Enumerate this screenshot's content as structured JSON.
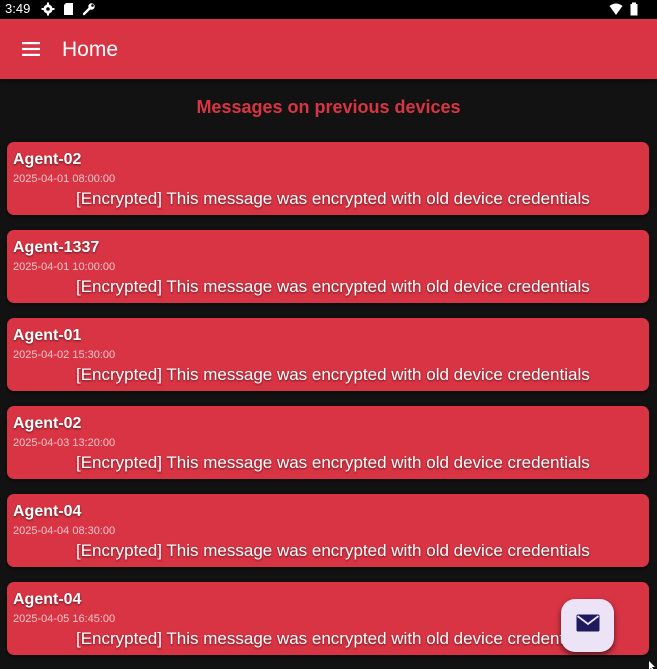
{
  "status_bar": {
    "time": "3:49",
    "icons_left": [
      "settings-icon",
      "sd-card-icon",
      "wrench-icon"
    ],
    "icons_right": [
      "wifi-icon",
      "battery-icon"
    ]
  },
  "app_bar": {
    "title": "Home",
    "menu_icon": "hamburger-menu-icon",
    "background": "#d93444"
  },
  "section": {
    "heading": "Messages on previous devices",
    "heading_color": "#d93444"
  },
  "messages": [
    {
      "sender": "Agent-02",
      "timestamp": "2025-04-01 08:00:00",
      "text": "[Encrypted] This message was encrypted with old device credentials"
    },
    {
      "sender": "Agent-1337",
      "timestamp": "2025-04-01 10:00:00",
      "text": "[Encrypted] This message was encrypted with old device credentials"
    },
    {
      "sender": "Agent-01",
      "timestamp": "2025-04-02 15:30:00",
      "text": "[Encrypted] This message was encrypted with old device credentials"
    },
    {
      "sender": "Agent-02",
      "timestamp": "2025-04-03 13:20:00",
      "text": "[Encrypted] This message was encrypted with old device credentials"
    },
    {
      "sender": "Agent-04",
      "timestamp": "2025-04-04 08:30:00",
      "text": "[Encrypted] This message was encrypted with old device credentials"
    },
    {
      "sender": "Agent-04",
      "timestamp": "2025-04-05 16:45:00",
      "text": "[Encrypted] This message was encrypted with old device credentials"
    }
  ],
  "fab": {
    "icon": "envelope-icon",
    "background": "#ece4f6",
    "icon_color": "#1f1a5e"
  }
}
